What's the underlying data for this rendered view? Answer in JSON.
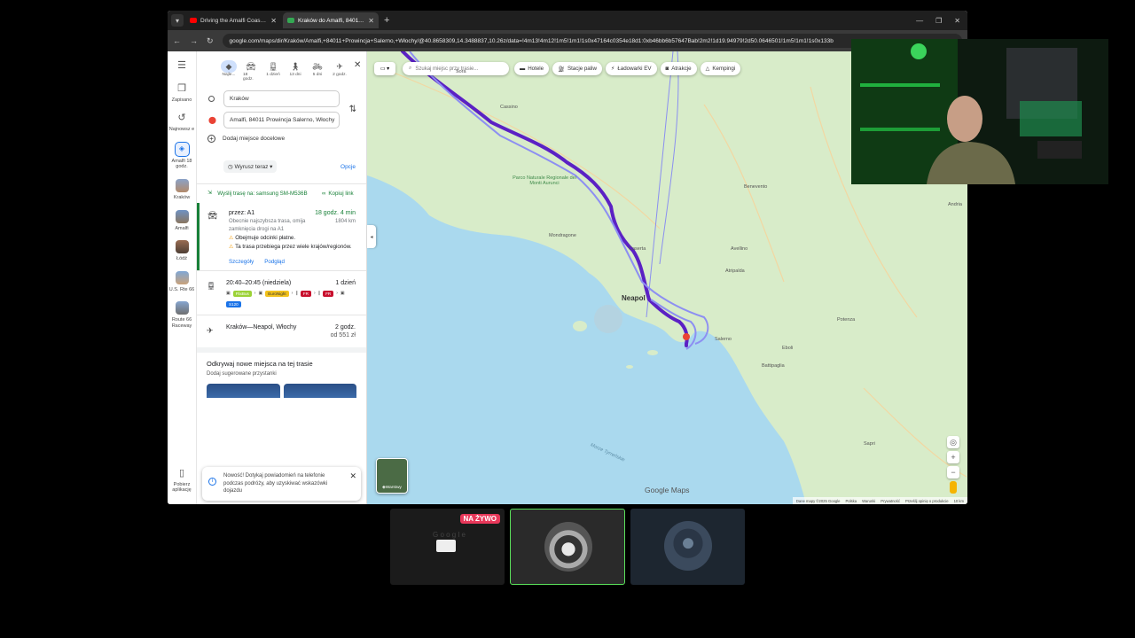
{
  "browser": {
    "tabs": [
      {
        "title": "Driving the Amalfi Coast - Italy",
        "favicon_color": "#ff0000"
      },
      {
        "title": "Kraków do Amalfi, 84011 Provi",
        "favicon_color": "#34a853"
      }
    ],
    "url": "google.com/maps/dir/Kraków/Amalfi,+84011+Prowincja+Salerno,+Włochy/@40.8658309,14.3488837,10.26z/data=!4m13!4m12!1m5!1m1!1s0x47164c0354e18d1:0xb46bb6b57647Bab!2m2!1d19.94979!2d50.0646501!1m5!1m1!1s0x133b"
  },
  "rail": {
    "menu_icon": "menu-icon",
    "saved": "Zapisano",
    "recent": "Najnowsz e",
    "amalfi": "Amalfi 18 godz.",
    "krakow": "Kraków",
    "amalfi2": "Amalfi",
    "lodz": "Łódź",
    "us66": "U.S. Rte 66",
    "route66": "Route 66 Raceway",
    "download": "Pobierz aplikację"
  },
  "modes": [
    {
      "label": "Najle...",
      "icon": "diamond-route-icon"
    },
    {
      "label": "18 godz.",
      "icon": "car-icon"
    },
    {
      "label": "1 dzień",
      "icon": "train-icon"
    },
    {
      "label": "13 dni",
      "icon": "walk-icon"
    },
    {
      "label": "5 dni",
      "icon": "bike-icon"
    },
    {
      "label": "2 godz.",
      "icon": "plane-icon"
    }
  ],
  "directions": {
    "origin": "Kraków",
    "destination": "Amalfi, 84011 Prowincja Salerno, Włochy",
    "add_destination": "Dodaj miejsce docelowe",
    "depart": "Wyrusz teraz",
    "options": "Opcje",
    "send": "Wyślij trasę na: samsung SM-M536B",
    "copy": "Kopiuj link"
  },
  "route": {
    "via": "przez: A1",
    "duration": "18 godz. 4 min",
    "note": "Obecnie najszybsza trasa, omija zamknięcia drogi na A1",
    "distance": "1804 km",
    "warn1": "Obejmuje odcinki płatne.",
    "warn2": "Ta trasa przebiega przez wiele krajów/regionów.",
    "details": "Szczegóły",
    "preview": "Podgląd"
  },
  "train": {
    "time": "20:40–20:45 (niedziela)",
    "duration": "1 dzień",
    "chips": [
      "FlixBus",
      "EuroNight",
      "FR",
      "FR",
      "S120"
    ]
  },
  "flight": {
    "route": "Kraków—Neapol, Włochy",
    "duration": "2 godz.",
    "price": "od 551 zł"
  },
  "discover": {
    "title": "Odkrywaj nowe miejsca na tej trasie",
    "subtitle": "Dodaj sugerowane przystanki"
  },
  "toast": {
    "text": "Nowość! Dotykaj powiadomień na telefonie podczas podróży, aby uzyskiwać wskazówki dojazdu"
  },
  "map": {
    "search_placeholder": "Szukaj miejsc przy trasie...",
    "filters": [
      {
        "label": "Hotele",
        "icon": "bed-icon"
      },
      {
        "label": "Stacje paliw",
        "icon": "fuel-icon"
      },
      {
        "label": "Ładowarki EV",
        "icon": "ev-charger-icon"
      },
      {
        "label": "Atrakcje",
        "icon": "camera-icon"
      },
      {
        "label": "Kempingi",
        "icon": "tent-icon"
      }
    ],
    "city": "Neapol",
    "labels": {
      "atripalda": "Atripalda",
      "avellino": "Avellino",
      "salerno": "Salerno",
      "mondragone": "Mondragone",
      "caserta": "Caserta",
      "potenza": "Potenza",
      "eboli": "Eboli",
      "battipaglia": "Battipaglia",
      "benevento": "Benevento",
      "sapri": "Sapri",
      "sora": "Sora",
      "cassino": "Cassino",
      "andria": "Andria",
      "park": "Parco Naturale Regionale dei Monti Aurunci",
      "sea": "Morze Tyrreńskie"
    },
    "layers": "Warstwy",
    "logo": "Google Maps",
    "attribution": [
      "Dane mapy ©2025 Google",
      "Polska",
      "Warunki",
      "Prywatność",
      "Prześlij opinię o produkcie",
      "10 km"
    ],
    "route_color": "#5b21c4"
  },
  "stream": {
    "live": "NA ŻYWO",
    "accent": "#5ae05a"
  }
}
